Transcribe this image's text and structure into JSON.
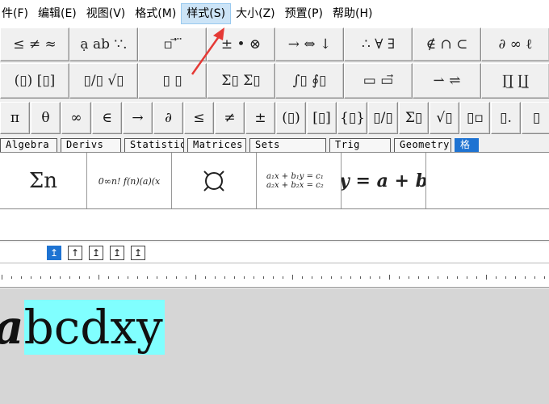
{
  "menu": [
    {
      "label": "件(F)"
    },
    {
      "label": "编辑(E)"
    },
    {
      "label": "视图(V)"
    },
    {
      "label": "格式(M)"
    },
    {
      "label": "样式(S)"
    },
    {
      "label": "大小(Z)"
    },
    {
      "label": "预置(P)"
    },
    {
      "label": "帮助(H)"
    }
  ],
  "palette_row1": [
    "≤ ≠ ≈",
    "ạ ab ∵.",
    "▫ ⃗ ⃛",
    "± • ⊗",
    "→ ⇔ ↓",
    "∴ ∀ ∃",
    "∉ ∩ ⊂",
    "∂ ∞ ℓ"
  ],
  "palette_row2": [
    "(▯) [▯]",
    "▯/▯ √▯",
    "▯ ▯",
    "Σ▯ Σ▯",
    "∫▯ ∮▯",
    "▭ ▭⃗",
    "⇀ ⇌",
    "∏̲ ∐̲"
  ],
  "symbols_row": [
    "π",
    "θ",
    "∞",
    "∈",
    "→",
    "∂",
    "≤",
    "≠",
    "±",
    "(▯)",
    "[▯]",
    "{▯}",
    "▯/▯",
    "Σ▯",
    "√▯",
    "▯▫",
    "▯.",
    "▯"
  ],
  "tabs": [
    "Algebra",
    "Derivs",
    "Statistics",
    "Matrices",
    "Sets",
    "Trig",
    "Geometry",
    "格"
  ],
  "templates": {
    "sum_n": "Σn",
    "funcs": "0∞n! f(n)(a)(x",
    "system_line1": "a₁x + b₁y = c₁",
    "system_line2": "a₂x + b₂x = c₂",
    "linear": "y = a + b"
  },
  "align_buttons": [
    "↥",
    "↑",
    "↥",
    "↥",
    "↥"
  ],
  "document": {
    "formula_italic": "a",
    "formula_rest": "bcdxy"
  },
  "colors": {
    "highlight": "#80ffff",
    "selected_tab": "#1e73d2",
    "annotation_arrow": "#e53935"
  }
}
